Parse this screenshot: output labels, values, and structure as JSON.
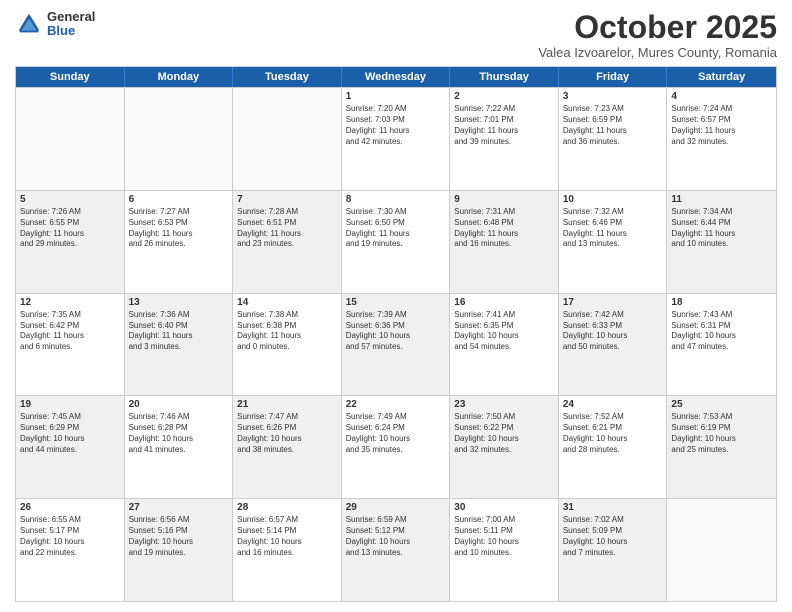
{
  "logo": {
    "general": "General",
    "blue": "Blue"
  },
  "title": "October 2025",
  "location": "Valea Izvoarelor, Mures County, Romania",
  "weekdays": [
    "Sunday",
    "Monday",
    "Tuesday",
    "Wednesday",
    "Thursday",
    "Friday",
    "Saturday"
  ],
  "rows": [
    [
      {
        "day": "",
        "info": "",
        "empty": true
      },
      {
        "day": "",
        "info": "",
        "empty": true
      },
      {
        "day": "",
        "info": "",
        "empty": true
      },
      {
        "day": "1",
        "info": "Sunrise: 7:20 AM\nSunset: 7:03 PM\nDaylight: 11 hours\nand 42 minutes."
      },
      {
        "day": "2",
        "info": "Sunrise: 7:22 AM\nSunset: 7:01 PM\nDaylight: 11 hours\nand 39 minutes."
      },
      {
        "day": "3",
        "info": "Sunrise: 7:23 AM\nSunset: 6:59 PM\nDaylight: 11 hours\nand 36 minutes."
      },
      {
        "day": "4",
        "info": "Sunrise: 7:24 AM\nSunset: 6:57 PM\nDaylight: 11 hours\nand 32 minutes."
      }
    ],
    [
      {
        "day": "5",
        "info": "Sunrise: 7:26 AM\nSunset: 6:55 PM\nDaylight: 11 hours\nand 29 minutes.",
        "shaded": true
      },
      {
        "day": "6",
        "info": "Sunrise: 7:27 AM\nSunset: 6:53 PM\nDaylight: 11 hours\nand 26 minutes."
      },
      {
        "day": "7",
        "info": "Sunrise: 7:28 AM\nSunset: 6:51 PM\nDaylight: 11 hours\nand 23 minutes.",
        "shaded": true
      },
      {
        "day": "8",
        "info": "Sunrise: 7:30 AM\nSunset: 6:50 PM\nDaylight: 11 hours\nand 19 minutes."
      },
      {
        "day": "9",
        "info": "Sunrise: 7:31 AM\nSunset: 6:48 PM\nDaylight: 11 hours\nand 16 minutes.",
        "shaded": true
      },
      {
        "day": "10",
        "info": "Sunrise: 7:32 AM\nSunset: 6:46 PM\nDaylight: 11 hours\nand 13 minutes."
      },
      {
        "day": "11",
        "info": "Sunrise: 7:34 AM\nSunset: 6:44 PM\nDaylight: 11 hours\nand 10 minutes.",
        "shaded": true
      }
    ],
    [
      {
        "day": "12",
        "info": "Sunrise: 7:35 AM\nSunset: 6:42 PM\nDaylight: 11 hours\nand 6 minutes."
      },
      {
        "day": "13",
        "info": "Sunrise: 7:36 AM\nSunset: 6:40 PM\nDaylight: 11 hours\nand 3 minutes.",
        "shaded": true
      },
      {
        "day": "14",
        "info": "Sunrise: 7:38 AM\nSunset: 6:38 PM\nDaylight: 11 hours\nand 0 minutes."
      },
      {
        "day": "15",
        "info": "Sunrise: 7:39 AM\nSunset: 6:36 PM\nDaylight: 10 hours\nand 57 minutes.",
        "shaded": true
      },
      {
        "day": "16",
        "info": "Sunrise: 7:41 AM\nSunset: 6:35 PM\nDaylight: 10 hours\nand 54 minutes."
      },
      {
        "day": "17",
        "info": "Sunrise: 7:42 AM\nSunset: 6:33 PM\nDaylight: 10 hours\nand 50 minutes.",
        "shaded": true
      },
      {
        "day": "18",
        "info": "Sunrise: 7:43 AM\nSunset: 6:31 PM\nDaylight: 10 hours\nand 47 minutes."
      }
    ],
    [
      {
        "day": "19",
        "info": "Sunrise: 7:45 AM\nSunset: 6:29 PM\nDaylight: 10 hours\nand 44 minutes.",
        "shaded": true
      },
      {
        "day": "20",
        "info": "Sunrise: 7:46 AM\nSunset: 6:28 PM\nDaylight: 10 hours\nand 41 minutes."
      },
      {
        "day": "21",
        "info": "Sunrise: 7:47 AM\nSunset: 6:26 PM\nDaylight: 10 hours\nand 38 minutes.",
        "shaded": true
      },
      {
        "day": "22",
        "info": "Sunrise: 7:49 AM\nSunset: 6:24 PM\nDaylight: 10 hours\nand 35 minutes."
      },
      {
        "day": "23",
        "info": "Sunrise: 7:50 AM\nSunset: 6:22 PM\nDaylight: 10 hours\nand 32 minutes.",
        "shaded": true
      },
      {
        "day": "24",
        "info": "Sunrise: 7:52 AM\nSunset: 6:21 PM\nDaylight: 10 hours\nand 28 minutes."
      },
      {
        "day": "25",
        "info": "Sunrise: 7:53 AM\nSunset: 6:19 PM\nDaylight: 10 hours\nand 25 minutes.",
        "shaded": true
      }
    ],
    [
      {
        "day": "26",
        "info": "Sunrise: 6:55 AM\nSunset: 5:17 PM\nDaylight: 10 hours\nand 22 minutes."
      },
      {
        "day": "27",
        "info": "Sunrise: 6:56 AM\nSunset: 5:16 PM\nDaylight: 10 hours\nand 19 minutes.",
        "shaded": true
      },
      {
        "day": "28",
        "info": "Sunrise: 6:57 AM\nSunset: 5:14 PM\nDaylight: 10 hours\nand 16 minutes."
      },
      {
        "day": "29",
        "info": "Sunrise: 6:59 AM\nSunset: 5:12 PM\nDaylight: 10 hours\nand 13 minutes.",
        "shaded": true
      },
      {
        "day": "30",
        "info": "Sunrise: 7:00 AM\nSunset: 5:11 PM\nDaylight: 10 hours\nand 10 minutes."
      },
      {
        "day": "31",
        "info": "Sunrise: 7:02 AM\nSunset: 5:09 PM\nDaylight: 10 hours\nand 7 minutes.",
        "shaded": true
      },
      {
        "day": "",
        "info": "",
        "empty": true
      }
    ]
  ]
}
